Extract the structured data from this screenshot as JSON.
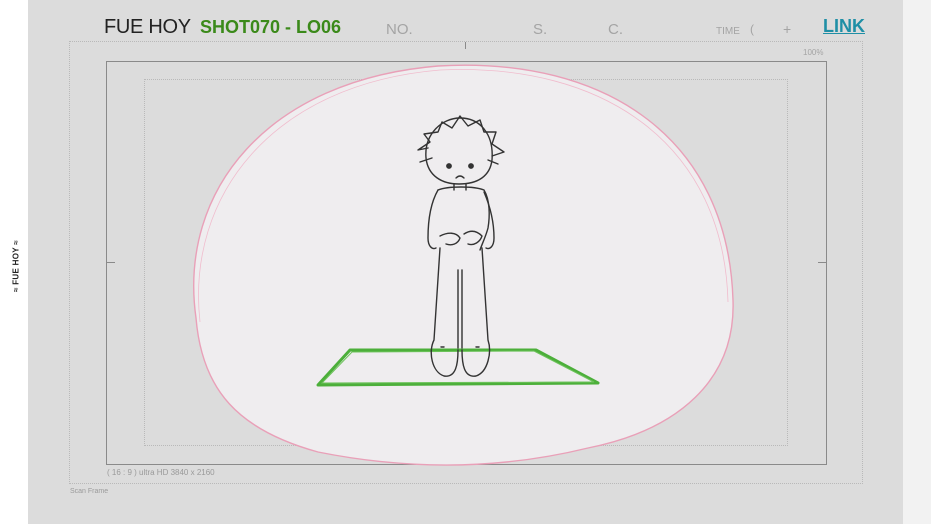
{
  "sidebar": {
    "label": "≈ FUE HOY ≈"
  },
  "header": {
    "title": "FUE HOY",
    "shot": "SHOT070 - LO06",
    "no_label": "NO.",
    "s_label": "S.",
    "c_label": "C.",
    "time_label": "TIME",
    "time_paren": "(",
    "time_plus": "+",
    "link": "LINK"
  },
  "frame": {
    "percent": "100%",
    "resolution": "( 16 : 9 ) ultra HD 3840 x 2160",
    "scan_frame": "Scan Frame"
  },
  "colors": {
    "shot": "#3b8a1a",
    "link": "#1f8fa6",
    "mat": "#4caf3a",
    "bubble_outline": "#e9a0b8"
  },
  "icons": {
    "character": "boy-sketch",
    "ground": "green-mat"
  }
}
